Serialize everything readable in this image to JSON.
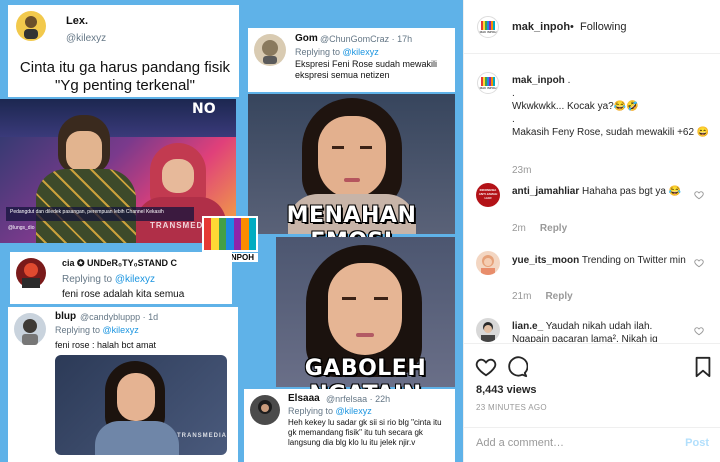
{
  "collage": {
    "tweet_lex": {
      "name": "Lex.",
      "handle": "@kilexyz",
      "line1": "Cinta itu ga harus pandang fisik",
      "line2": "\"Yg penting terkenal\""
    },
    "photo1": {
      "badge": "TRANSMEDIA",
      "caption_text": "Pedangdut dan diledek pasangan, perempuan lebih Channel Kekasih",
      "watermark": "@lungs_dio"
    },
    "tweet_gom": {
      "name": "Gom",
      "handle": "@ChunGomCraz · 17h",
      "replying": "Replying to",
      "replying_handle": "@kilexyz",
      "text": "Ekspresi Feni Rose sudah mewakili ekspresi semua netizen"
    },
    "caption_top": "MENAHAN EMOSI",
    "caption_bottom": "GABOLEH NGATAIN",
    "logo_label": "MAK_INPOH",
    "tweet_cia": {
      "name": "cia ✪ UNDeR₀TY₀STAND C",
      "replying": "Replying to",
      "replying_handle": "@kilexyz",
      "text": "feni rose adalah kita semua"
    },
    "tweet_blup": {
      "name": "blup",
      "handle": "@candybluppp · 1d",
      "replying": "Replying to",
      "replying_handle": "@kilexyz",
      "text": "feni rose : halah bct amat",
      "photo_badge": "TRANSMEDIA"
    },
    "tweet_elsaaa": {
      "name": "Elsaaa",
      "handle": "@nrfelsaa · 22h",
      "replying": "Replying to",
      "replying_handle": "@kilexyz",
      "text": "Heh kekey lu sadar gk sii si rio blg \"cinta itu gk memandang fisik\" itu tuh secara gk langsung dia blg klo lu itu jelek njir.v"
    }
  },
  "header": {
    "username": "mak_inpoh",
    "separator": "•",
    "follow": "Following",
    "logo_text": "MAK INPOH"
  },
  "caption": {
    "username": "mak_inpoh",
    "text1": ".",
    "dot": ".",
    "text2": "Wkwkwkk... Kocak ya?😂🤣",
    "dot2": ".",
    "text3": "Makasih Feny Rose, sudah mewakili +62 😄",
    "age": "23m"
  },
  "comments": [
    {
      "username": "anti_jamahliar",
      "text": "Hahaha pas bgt ya 😂",
      "age": "2m",
      "reply": "Reply",
      "avatar_text": "INDONESIA ANTI JAMAH LIAR"
    },
    {
      "username": "yue_its_moon",
      "text": "Trending on Twitter min",
      "age": "21m",
      "reply": "Reply"
    },
    {
      "username": "lian.e_",
      "text": "Yaudah nikah udah ilah. Ngapain pacaran lama². Nikah jg"
    }
  ],
  "actions": {
    "views": "8,443 views",
    "posted": "23 MINUTES AGO"
  },
  "add_comment": {
    "placeholder": "Add a comment…",
    "post": "Post"
  },
  "colors": {
    "media_bg": "#5fb2e8",
    "link": "#1b95e0",
    "post_button": "#b2dffc",
    "logo_bars": [
      "#e53935",
      "#fdd835",
      "#43a047",
      "#1e88e5",
      "#8e24aa",
      "#fb8c00",
      "#00acc1"
    ]
  }
}
